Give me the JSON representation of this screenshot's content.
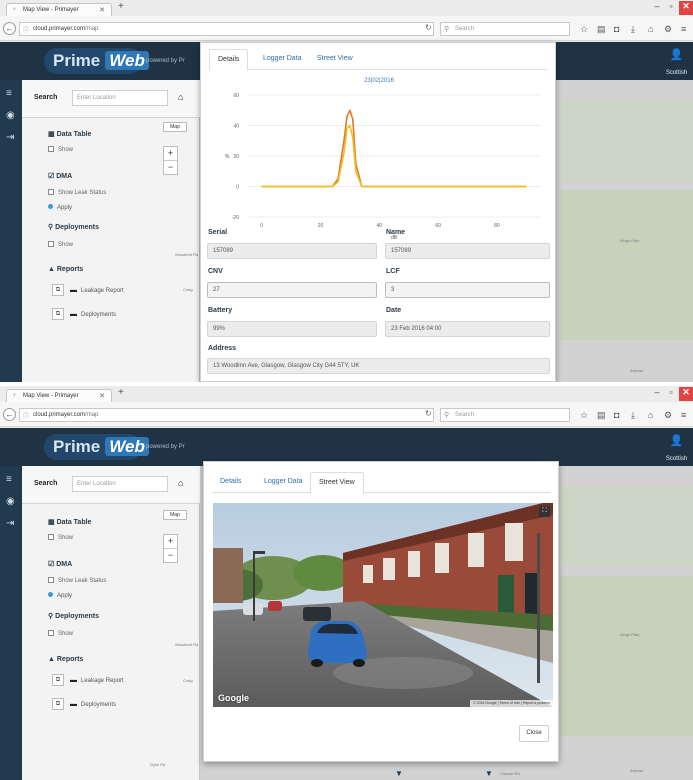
{
  "browser": {
    "tab_title": "Map View - Primayer",
    "url_host": "cloud.primayer.com",
    "url_path": "/map",
    "search_placeholder": "Search"
  },
  "app": {
    "brand_prime": "Prime",
    "brand_web": "Web",
    "powered_by": "powered by Pr",
    "user_name": "Scottish"
  },
  "sidebar": {
    "search_label": "Search",
    "search_placeholder": "Enter Location",
    "data_table_heading": "Data Table",
    "show_label": "Show",
    "dma_heading": "DMA",
    "show_leak_status": "Show Leak Status",
    "apply_label": "Apply",
    "deployments_heading": "Deployments",
    "deployments_show": "Show",
    "reports_heading": "Reports",
    "leakage_report": "Leakage Report",
    "deployments_report": "Deployments"
  },
  "map": {
    "map_type": "Map",
    "zoom_in": "+",
    "zoom_out": "−",
    "roads": [
      "Woodfoot Rd",
      "Craig",
      "Dyke Rd",
      "Kings Park",
      "Ardnish",
      "Clincart Rd"
    ]
  },
  "modal": {
    "tabs": [
      "Details",
      "Logger Data",
      "Street View"
    ],
    "active_tab_top": "Details",
    "active_tab_bottom": "Street View",
    "close_label": "Close",
    "fields": {
      "serial_label": "Serial",
      "serial_value": "157089",
      "name_label": "Name",
      "name_value": "157089",
      "cnv_label": "CNV",
      "cnv_value": "27",
      "lcf_label": "LCF",
      "lcf_value": "3",
      "battery_label": "Battery",
      "battery_value": "99%",
      "date_label": "Date",
      "date_value": "23 Feb 2016 04:00",
      "address_label": "Address",
      "address_value": "13 Woodlinn Ave, Glasgow, Glasgow City G44 5TY, UK"
    },
    "street_view": {
      "google_label": "Google",
      "legal_text": "© 2016 Google | Terms of Use | Report a problem"
    }
  },
  "chart_data": {
    "type": "line",
    "title": "23|02|2016",
    "xlabel": "dB",
    "ylabel": "%",
    "xlim": [
      -5,
      95
    ],
    "ylim": [
      -20,
      60
    ],
    "x_ticks": [
      0,
      20,
      40,
      60,
      80
    ],
    "y_ticks": [
      -20,
      0,
      20,
      40,
      60
    ],
    "grid": true,
    "series": [
      {
        "color": "#e07a2a",
        "x": [
          0,
          24,
          26,
          28,
          29,
          30,
          31,
          32,
          34,
          36,
          90
        ],
        "y": [
          0,
          0,
          5,
          30,
          46,
          50,
          44,
          15,
          0,
          0,
          0
        ]
      },
      {
        "color": "#f0c020",
        "x": [
          0,
          24,
          26,
          28,
          29,
          30,
          31,
          32,
          34,
          36,
          90
        ],
        "y": [
          0,
          0,
          3,
          22,
          38,
          40,
          32,
          10,
          0,
          0,
          0
        ]
      }
    ]
  }
}
